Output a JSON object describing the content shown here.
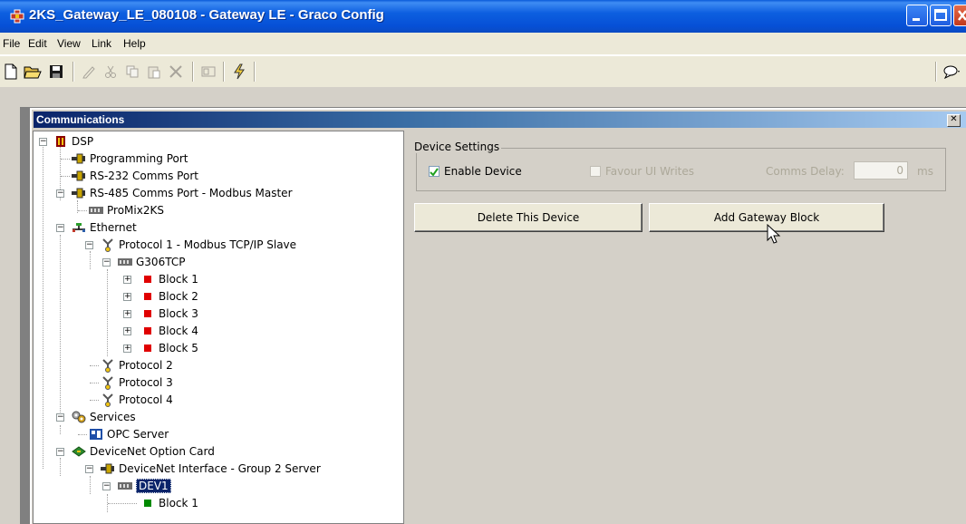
{
  "window": {
    "title": "2KS_Gateway_LE_080108 - Gateway LE - Graco Config"
  },
  "menu": [
    "File",
    "Edit",
    "View",
    "Link",
    "Help"
  ],
  "child_window": {
    "title": "Communications"
  },
  "tree": {
    "nodes": [
      {
        "label": "DSP",
        "icon": "dsp-icon"
      },
      {
        "label": "Programming Port",
        "icon": "port-icon"
      },
      {
        "label": "RS-232 Comms Port",
        "icon": "port-icon"
      },
      {
        "label": "RS-485 Comms Port - Modbus Master",
        "icon": "port-icon"
      },
      {
        "label": "ProMix2KS",
        "icon": "device-icon"
      },
      {
        "label": "Ethernet",
        "icon": "ethernet-icon"
      },
      {
        "label": "Protocol 1 - Modbus TCP/IP Slave",
        "icon": "protocol-icon"
      },
      {
        "label": "G306TCP",
        "icon": "device-icon"
      },
      {
        "label": "Block 1",
        "icon": "red-block-icon"
      },
      {
        "label": "Block 2",
        "icon": "red-block-icon"
      },
      {
        "label": "Block 3",
        "icon": "red-block-icon"
      },
      {
        "label": "Block 4",
        "icon": "red-block-icon"
      },
      {
        "label": "Block 5",
        "icon": "red-block-icon"
      },
      {
        "label": "Protocol 2",
        "icon": "protocol-icon"
      },
      {
        "label": "Protocol 3",
        "icon": "protocol-icon"
      },
      {
        "label": "Protocol 4",
        "icon": "protocol-icon"
      },
      {
        "label": "Services",
        "icon": "services-icon"
      },
      {
        "label": "OPC Server",
        "icon": "opc-icon"
      },
      {
        "label": "DeviceNet Option Card",
        "icon": "card-icon"
      },
      {
        "label": "DeviceNet Interface - Group 2 Server",
        "icon": "port-icon"
      },
      {
        "label": "DEV1",
        "icon": "device-icon"
      },
      {
        "label": "Block 1",
        "icon": "green-block-icon"
      }
    ]
  },
  "device_settings": {
    "legend": "Device Settings",
    "enable_device_label": "Enable Device",
    "enable_device_checked": true,
    "favour_ui_writes_label": "Favour UI Writes",
    "favour_ui_writes_checked": false,
    "comms_delay_label": "Comms Delay:",
    "comms_delay_value": "0",
    "comms_delay_unit": "ms"
  },
  "buttons": {
    "delete_device": "Delete This Device",
    "add_gateway_block": "Add Gateway Block"
  },
  "colors": {
    "titlebar": "#0a5ad8",
    "child_title_start": "#0a246a",
    "selection": "#0a246a",
    "red_block": "#e00000",
    "green_block": "#008a00"
  }
}
